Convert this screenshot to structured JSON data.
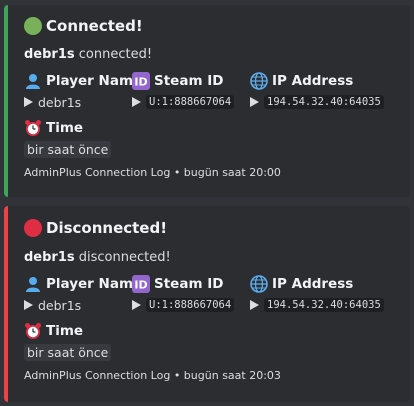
{
  "embeds": [
    {
      "status_icon": "green-circle-icon",
      "title": "Connected!",
      "user": "debr1s",
      "action": "connected!",
      "fields": {
        "player_name_label": "Player Name",
        "player_name_value": "debr1s",
        "steam_id_label": "Steam ID",
        "steam_id_value": "U:1:888667064",
        "ip_label": "IP Address",
        "ip_value": "194.54.32.40:64035",
        "time_label": "Time",
        "time_value": "bir saat önce"
      },
      "footer": "AdminPlus Connection Log • bugün saat 20:00",
      "accent": "#3ba55c"
    },
    {
      "status_icon": "red-circle-icon",
      "title": "Disconnected!",
      "user": "debr1s",
      "action": "disconnected!",
      "fields": {
        "player_name_label": "Player Name",
        "player_name_value": "debr1s",
        "steam_id_label": "Steam ID",
        "steam_id_value": "U:1:888667064",
        "ip_label": "IP Address",
        "ip_value": "194.54.32.40:64035",
        "time_label": "Time",
        "time_value": "bir saat önce"
      },
      "footer": "AdminPlus Connection Log • bugün saat 20:03",
      "accent": "#ed4245"
    }
  ],
  "icons": {
    "player": "bust-in-silhouette-icon",
    "steam": "id-button-icon",
    "ip": "globe-icon",
    "time": "alarm-clock-icon",
    "value_marker": "play-triangle-icon"
  }
}
